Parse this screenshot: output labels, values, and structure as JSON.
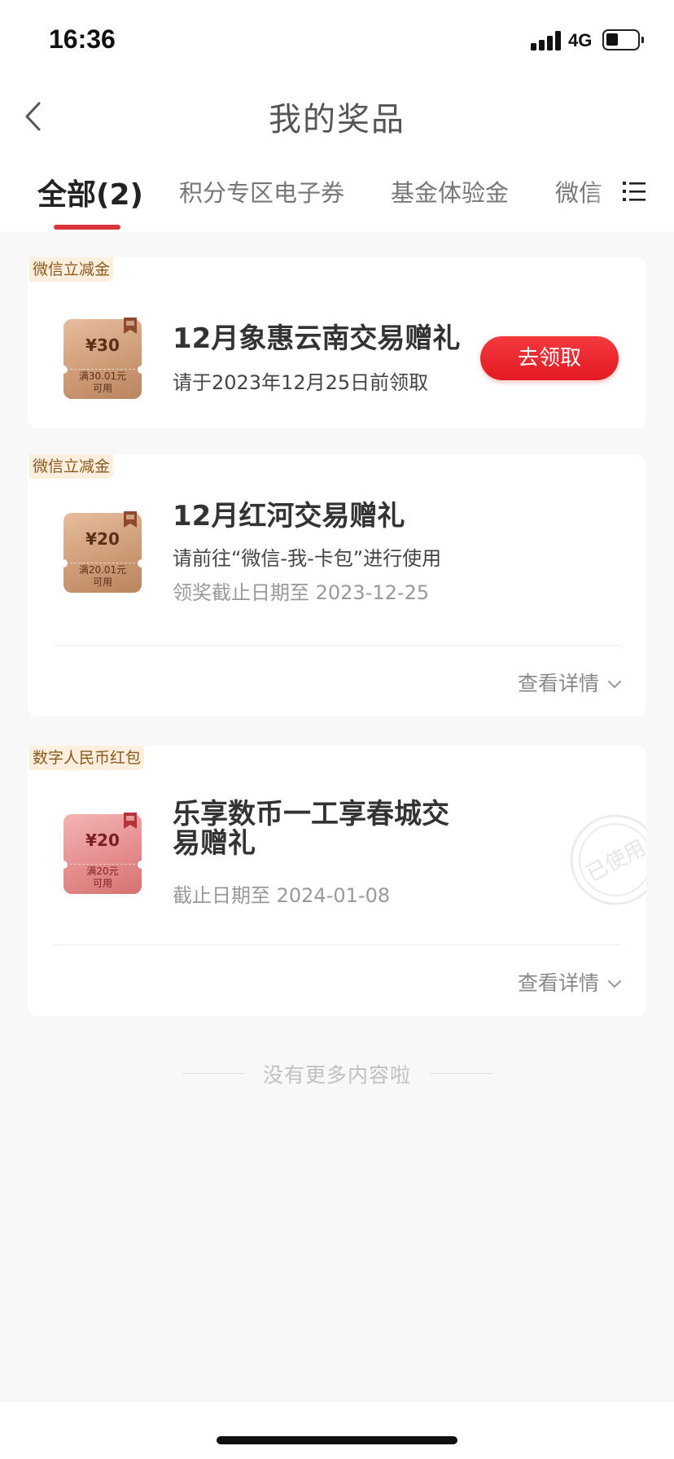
{
  "status": {
    "time": "16:36",
    "network": "4G"
  },
  "nav": {
    "title": "我的奖品",
    "back_icon": "chevron-left-icon"
  },
  "tabs": [
    {
      "label": "全部(2)",
      "active": true
    },
    {
      "label": "积分专区电子券",
      "active": false
    },
    {
      "label": "基金体验金",
      "active": false
    },
    {
      "label": "微信",
      "active": false
    }
  ],
  "tab_menu_icon": "list-menu-icon",
  "colors": {
    "accent": "#d9343b",
    "button": "#e41a22",
    "tag_text": "#8a5a1c",
    "tag_bg": "#fdeede"
  },
  "prizes": [
    {
      "tag": "微信立减金",
      "coupon": {
        "amount": "¥30",
        "condition_line1": "满30.01元",
        "condition_line2": "可用",
        "style": "brown"
      },
      "title": "12月象惠云南交易赠礼",
      "subtitle": "请于2023年12月25日前领取",
      "action": "去领取"
    },
    {
      "tag": "微信立减金",
      "coupon": {
        "amount": "¥20",
        "condition_line1": "满20.01元",
        "condition_line2": "可用",
        "style": "brown"
      },
      "title": "12月红河交易赠礼",
      "subtitle": "请前往“微信-我-卡包”进行使用",
      "deadline": "领奖截止日期至 2023-12-25",
      "detail": "查看详情"
    },
    {
      "tag": "数字人民币红包",
      "coupon": {
        "amount": "¥20",
        "condition_line1": "满20元",
        "condition_line2": "可用",
        "style": "pink"
      },
      "title_line1": "乐享数币一工享春城交",
      "title_line2": "易赠礼",
      "deadline": "截止日期至 2024-01-08",
      "stamp": "已使用",
      "detail": "查看详情"
    }
  ],
  "footer": {
    "no_more": "没有更多内容啦"
  }
}
